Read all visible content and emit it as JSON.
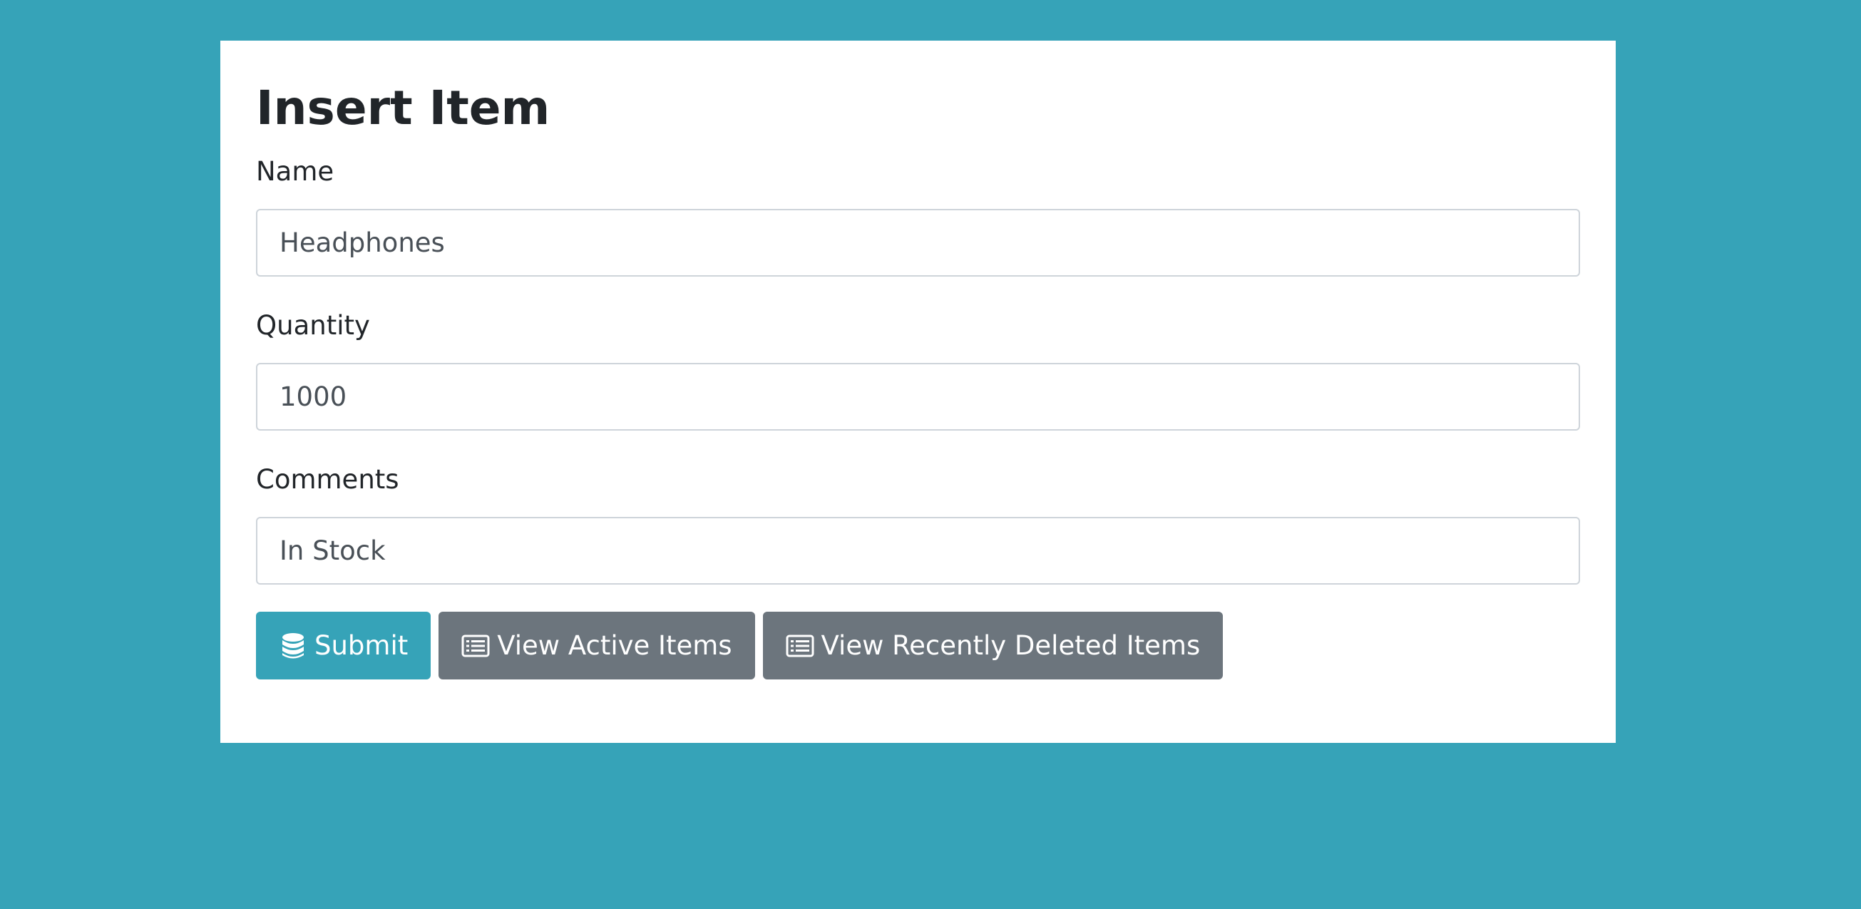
{
  "page": {
    "title": "Insert Item"
  },
  "form": {
    "name": {
      "label": "Name",
      "value": "Headphones"
    },
    "quantity": {
      "label": "Quantity",
      "value": "1000"
    },
    "comments": {
      "label": "Comments",
      "value": "In Stock"
    }
  },
  "buttons": {
    "submit": {
      "label": "Submit",
      "icon": "database-icon"
    },
    "view_active": {
      "label": "View Active Items",
      "icon": "list-icon"
    },
    "view_deleted": {
      "label": "View Recently Deleted Items",
      "icon": "list-icon"
    }
  },
  "colors": {
    "background": "#36a3b8",
    "primary": "#36a3b8",
    "secondary": "#6c757d"
  }
}
